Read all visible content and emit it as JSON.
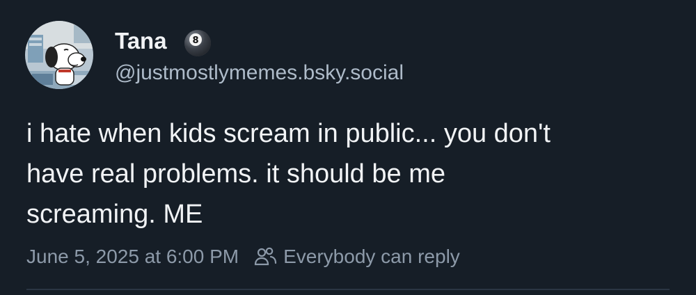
{
  "author": {
    "display_name": "Tana",
    "handle": "@justmostlymemes.bsky.social",
    "avatar_icon": "snoopy-avatar",
    "badge_icon": "pool-ball-8-icon"
  },
  "post": {
    "text": "i hate when kids scream in public... you don't\nhave real problems. it should be me\nscreaming. ME",
    "timestamp": "June 5, 2025 at 6:00 PM",
    "reply_setting": "Everybody can reply",
    "reply_icon": "people-icon"
  },
  "colors": {
    "background": "#161e27",
    "text_primary": "#f1f3f5",
    "text_secondary": "#8d9aa9",
    "handle": "#aebbc9"
  }
}
